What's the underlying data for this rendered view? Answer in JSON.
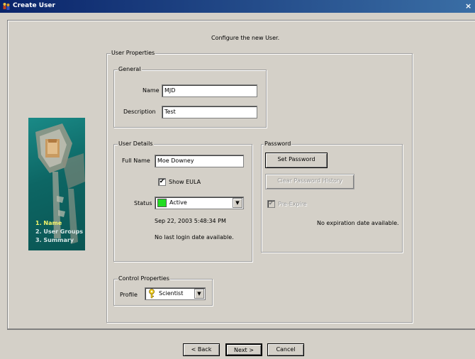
{
  "window": {
    "title": "Create User",
    "close_glyph": "×"
  },
  "header": {
    "instruction": "Configure the new User."
  },
  "wizard": {
    "steps": [
      {
        "label": "1. Name",
        "color": "#f5f56a"
      },
      {
        "label": "2. User Groups",
        "color": "#d8e6e6"
      },
      {
        "label": "3. Summary",
        "color": "#d8e6e6"
      }
    ],
    "active_step": 0
  },
  "user_properties": {
    "legend": "User Properties",
    "general": {
      "legend": "General",
      "name_label": "Name",
      "name_value": "MJD",
      "description_label": "Description",
      "description_value": "Test"
    },
    "user_details": {
      "legend": "User Details",
      "full_name_label": "Full Name",
      "full_name_value": "Moe Downey",
      "show_eula_label": "Show EULA",
      "show_eula_checked": true,
      "status_label": "Status",
      "status_value": "Active",
      "status_color": "#22dd22",
      "created_text": "Sep 22, 2003 5:48:34 PM",
      "last_login_text": "No last login date available."
    },
    "password": {
      "legend": "Password",
      "set_password_label": "Set Password",
      "clear_history_label": "Clear Password History",
      "pre_expire_label": "Pre-Expire",
      "pre_expire_checked": true,
      "expiration_text": "No expiration date available."
    },
    "control_properties": {
      "legend": "Control Properties",
      "profile_label": "Profile",
      "profile_value": "Scientist",
      "profile_icon": "key-icon"
    }
  },
  "footer": {
    "back_label": "< Back",
    "next_label": "Next >",
    "cancel_label": "Cancel"
  },
  "icons": {
    "app": "app-icon",
    "check": "✔",
    "dropdown": "▼"
  }
}
